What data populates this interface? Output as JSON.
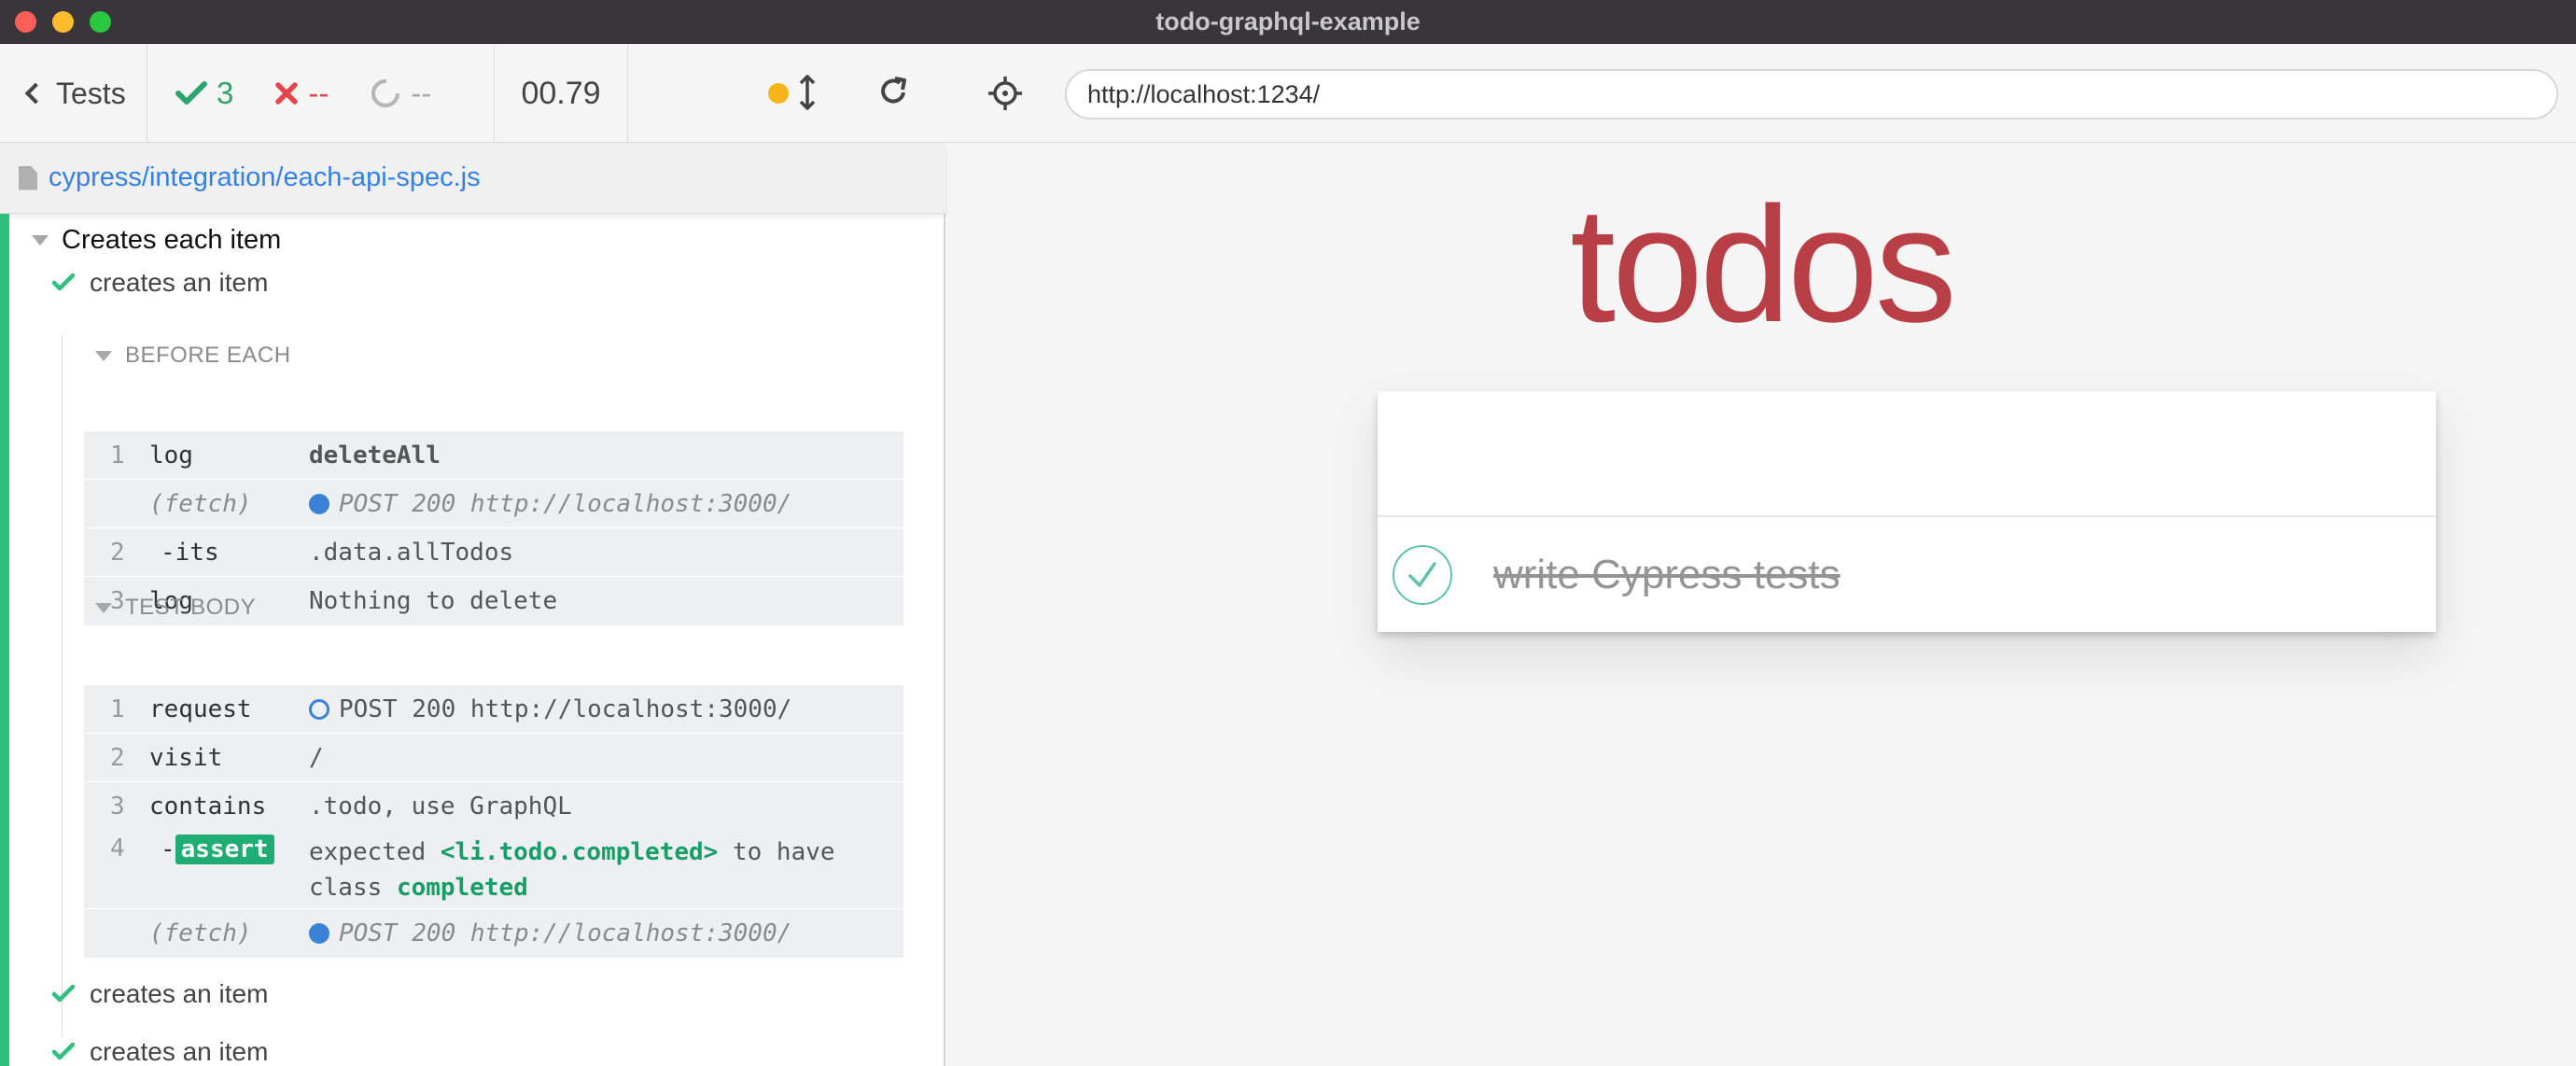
{
  "window": {
    "title": "todo-graphql-example"
  },
  "reporter": {
    "tests_label": "Tests",
    "passed": "3",
    "failed": "--",
    "pending": "--",
    "duration": "00.79",
    "spec_path": "cypress/integration/each-api-spec.js"
  },
  "suite": {
    "title": "Creates each item",
    "tests": [
      {
        "title": "creates an item"
      },
      {
        "title": "creates an item"
      },
      {
        "title": "creates an item"
      }
    ],
    "before_each": {
      "label": "BEFORE EACH",
      "commands": [
        {
          "num": "1",
          "name": "log",
          "msg": "deleteAll"
        },
        {
          "num": "",
          "name": "(fetch)",
          "msg": "POST 200 http://localhost:3000/"
        },
        {
          "num": "2",
          "name": "-its",
          "msg": ".data.allTodos"
        },
        {
          "num": "3",
          "name": "log",
          "msg": "Nothing to delete"
        }
      ]
    },
    "test_body": {
      "label": "TEST BODY",
      "commands": [
        {
          "num": "1",
          "name": "request",
          "msg": "POST 200 http://localhost:3000/"
        },
        {
          "num": "2",
          "name": "visit",
          "msg": "/"
        },
        {
          "num": "3",
          "name": "contains",
          "msg": ".todo, use GraphQL"
        },
        {
          "num": "4",
          "name": "assert",
          "msg_parts": [
            "expected",
            "<li.todo.completed>",
            "to have",
            "class",
            "completed"
          ]
        },
        {
          "num": "",
          "name": "(fetch)",
          "msg": "POST 200 http://localhost:3000/"
        }
      ]
    }
  },
  "aut": {
    "url": "http://localhost:1234/",
    "heading": "todos",
    "todo_item": "write Cypress tests"
  },
  "colors": {
    "pass": "#2fbf7e",
    "fail": "#e5454c",
    "accent": "#b83f45",
    "link": "#3380ea"
  }
}
